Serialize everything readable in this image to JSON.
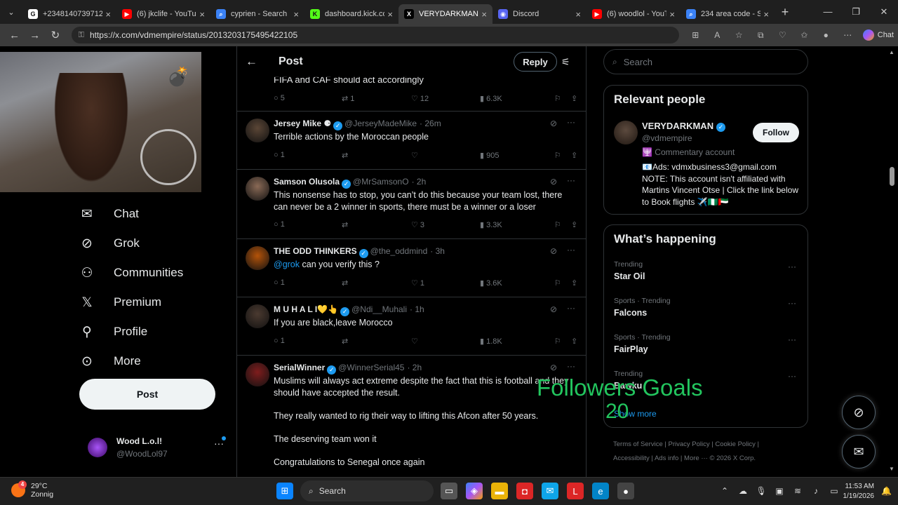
{
  "browser": {
    "tabs": [
      {
        "title": "+2348140739712 w",
        "fav_color": "#ffffff",
        "fav_text": "G"
      },
      {
        "title": "(6) jkclife - YouTube",
        "fav_color": "#ff0000",
        "fav_text": "▶"
      },
      {
        "title": "cyprien - Search",
        "fav_color": "#3b82f6",
        "fav_text": "⌕"
      },
      {
        "title": "dashboard.kick.com",
        "fav_color": "#53fc18",
        "fav_text": "K"
      },
      {
        "title": "VERYDARKMAN on",
        "fav_color": "#000000",
        "fav_text": "X"
      },
      {
        "title": "Discord",
        "fav_color": "#5865f2",
        "fav_text": "◉"
      },
      {
        "title": "(6) woodlol - YouTu",
        "fav_color": "#ff0000",
        "fav_text": "▶"
      },
      {
        "title": "234 area code - Sea",
        "fav_color": "#3b82f6",
        "fav_text": "⌕"
      }
    ],
    "url": "https://x.com/vdmempire/status/2013203175495422105",
    "chat_label": "Chat"
  },
  "nav": {
    "items": [
      {
        "label": "Chat",
        "icon": "✉"
      },
      {
        "label": "Grok",
        "icon": "⊘"
      },
      {
        "label": "Communities",
        "icon": "⚇"
      },
      {
        "label": "Premium",
        "icon": "𝕏"
      },
      {
        "label": "Profile",
        "icon": "⚲"
      },
      {
        "label": "More",
        "icon": "⊙"
      }
    ],
    "post_label": "Post",
    "user_name": "Wood L.o.l!",
    "user_handle": "@WoodLol97"
  },
  "feed": {
    "title": "Post",
    "reply_label": "Reply",
    "fragment_text": "FIFA and CAF should act accordingly",
    "fragment_actions": {
      "replies": "5",
      "reposts": "1",
      "likes": "12",
      "views": "6.3K"
    },
    "tweets": [
      {
        "name": "Jersey Mike ⚈",
        "handle": "@JerseyMadeMike",
        "time": "· 26m",
        "body": [
          "Terrible actions by the Moroccan people"
        ],
        "replies": "1",
        "reposts": "",
        "likes": "",
        "views": "905",
        "avatar": "#5b4636"
      },
      {
        "name": "Samson Olusola",
        "handle": "@MrSamsonO",
        "time": "· 2h",
        "body": [
          "This nonsense has to stop, you can’t do this because your team lost, there can never be a 2 winner in sports, there must be a winner or a loser"
        ],
        "replies": "1",
        "reposts": "",
        "likes": "3",
        "views": "3.3K",
        "avatar": "#8a6a56"
      },
      {
        "name": "THE ODD THINKERS",
        "handle": "@the_oddmind",
        "time": "· 3h",
        "mention": "@grok",
        "body": [
          "can you verify this ?"
        ],
        "replies": "1",
        "reposts": "",
        "likes": "1",
        "views": "3.6K",
        "avatar": "#b45309"
      },
      {
        "name": "M U H A L I💛👆",
        "handle": "@Ndi__Muhali",
        "time": "· 1h",
        "body": [
          "If you are black,leave Morocco"
        ],
        "replies": "1",
        "reposts": "",
        "likes": "",
        "views": "1.8K",
        "avatar": "#4b3a30"
      },
      {
        "name": "SerialWinner",
        "handle": "@WinnerSerial45",
        "time": "· 2h",
        "body": [
          "Muslims will always act extreme despite the fact that this is football and they should have accepted the result.",
          "They really wanted to rig their way to lifting this Afcon after 50 years.",
          "The deserving team won it",
          "Congratulations to Senegal once again"
        ],
        "replies": "",
        "reposts": "",
        "likes": "",
        "views": "",
        "avatar": "#7f1d1d"
      }
    ]
  },
  "right": {
    "search_placeholder": "Search",
    "relevant_title": "Relevant people",
    "person_name": "VERYDARKMAN",
    "person_handle": "@vdmempire",
    "follow_label": "Follow",
    "account_type": "🕎 Commentary account",
    "bio": "📧Ads: vdmxbusiness3@gmail.com NOTE: This account isn't affiliated with Martins Vincent Otse | Click the link below to Book flights ✈️🇳🇬🇦🇪",
    "happening_title": "What’s happening",
    "trends": [
      {
        "context": "Trending",
        "name": "Star Oil"
      },
      {
        "context": "Sports · Trending",
        "name": "Falcons"
      },
      {
        "context": "Sports · Trending",
        "name": "FairPlay"
      },
      {
        "context": "Trending",
        "name": "Bawku"
      }
    ],
    "show_more": "Show more",
    "footer_line1": "Terms of Service  |  Privacy Policy  |  Cookie Policy  |",
    "footer_line2": "Accessibility  |  Ads info  |  More ···  © 2026 X Corp."
  },
  "overlay": {
    "line1": "Followers Goals",
    "line2": "20"
  },
  "taskbar": {
    "temp": "29°C",
    "condition": "Zonnig",
    "badge": "4",
    "search_label": "Search",
    "time": "11:53 AM",
    "date": "1/19/2026"
  }
}
